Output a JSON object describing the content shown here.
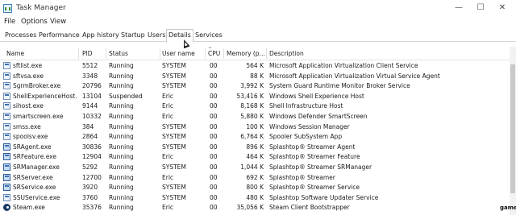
{
  "window": {
    "title": "Task Manager",
    "minimize_glyph": "—",
    "maximize_glyph": "☐",
    "close_glyph": "✕"
  },
  "menu": {
    "file": "File",
    "options": "Options",
    "view": "View"
  },
  "tabs": [
    {
      "label": "Processes"
    },
    {
      "label": "Performance"
    },
    {
      "label": "App history"
    },
    {
      "label": "Startup"
    },
    {
      "label": "Users"
    },
    {
      "label": "Details",
      "active": true
    },
    {
      "label": "Services"
    }
  ],
  "columns": {
    "name": "Name",
    "pid": "PID",
    "status": "Status",
    "user": "User name",
    "cpu": "CPU",
    "memory": "Memory (p...",
    "description": "Description",
    "sort_glyph": "^"
  },
  "rows": [
    {
      "name": "sftlist.exe",
      "pid": "5512",
      "status": "Running",
      "user": "SYSTEM",
      "cpu": "00",
      "memory": "564 K",
      "description": "Microsoft Application Virtualization Client Service",
      "icon": "app-window-icon"
    },
    {
      "name": "sftvsa.exe",
      "pid": "3348",
      "status": "Running",
      "user": "SYSTEM",
      "cpu": "00",
      "memory": "88 K",
      "description": "Microsoft Application Virtualization Virtual Service Agent",
      "icon": "app-window-icon"
    },
    {
      "name": "SgrmBroker.exe",
      "pid": "20796",
      "status": "Running",
      "user": "SYSTEM",
      "cpu": "00",
      "memory": "3,992 K",
      "description": "System Guard Runtime Monitor Broker Service",
      "icon": "app-window-icon"
    },
    {
      "name": "ShellExperienceHost....",
      "pid": "13104",
      "status": "Suspended",
      "user": "Eric",
      "cpu": "00",
      "memory": "53,416 K",
      "description": "Windows Shell Experience Host",
      "icon": "app-window-icon"
    },
    {
      "name": "sihost.exe",
      "pid": "9144",
      "status": "Running",
      "user": "Eric",
      "cpu": "00",
      "memory": "8,168 K",
      "description": "Shell Infrastructure Host",
      "icon": "app-window-icon"
    },
    {
      "name": "smartscreen.exe",
      "pid": "10332",
      "status": "Running",
      "user": "Eric",
      "cpu": "00",
      "memory": "5,880 K",
      "description": "Windows Defender SmartScreen",
      "icon": "app-window-icon"
    },
    {
      "name": "smss.exe",
      "pid": "384",
      "status": "Running",
      "user": "SYSTEM",
      "cpu": "00",
      "memory": "100 K",
      "description": "Windows Session Manager",
      "icon": "app-window-icon"
    },
    {
      "name": "spoolsv.exe",
      "pid": "2864",
      "status": "Running",
      "user": "SYSTEM",
      "cpu": "00",
      "memory": "6,764 K",
      "description": "Spooler SubSystem App",
      "icon": "printer-icon"
    },
    {
      "name": "SRAgent.exe",
      "pid": "30836",
      "status": "Running",
      "user": "SYSTEM",
      "cpu": "00",
      "memory": "896 K",
      "description": "Splashtop® Streamer Agent",
      "icon": "splashtop-icon"
    },
    {
      "name": "SRFeature.exe",
      "pid": "12904",
      "status": "Running",
      "user": "Eric",
      "cpu": "00",
      "memory": "464 K",
      "description": "Splashtop® Streamer Feature",
      "icon": "splashtop-icon"
    },
    {
      "name": "SRManager.exe",
      "pid": "5292",
      "status": "Running",
      "user": "SYSTEM",
      "cpu": "00",
      "memory": "1,044 K",
      "description": "Splashtop® Streamer SRManager",
      "icon": "splashtop-icon"
    },
    {
      "name": "SRServer.exe",
      "pid": "12700",
      "status": "Running",
      "user": "Eric",
      "cpu": "00",
      "memory": "692 K",
      "description": "Splashtop® Streamer",
      "icon": "splashtop-icon"
    },
    {
      "name": "SRService.exe",
      "pid": "3920",
      "status": "Running",
      "user": "SYSTEM",
      "cpu": "00",
      "memory": "800 K",
      "description": "Splashtop® Streamer Service",
      "icon": "splashtop-icon"
    },
    {
      "name": "SSUService.exe",
      "pid": "3760",
      "status": "Running",
      "user": "SYSTEM",
      "cpu": "00",
      "memory": "480 K",
      "description": "Splashtop Software Updater Service",
      "icon": "app-window-icon"
    },
    {
      "name": "Steam.exe",
      "pid": "35376",
      "status": "Running",
      "user": "Eric",
      "cpu": "00",
      "memory": "35,056 K",
      "description": "Steam Client Bootstrapper",
      "icon": "steam-icon"
    }
  ],
  "watermark": "game"
}
